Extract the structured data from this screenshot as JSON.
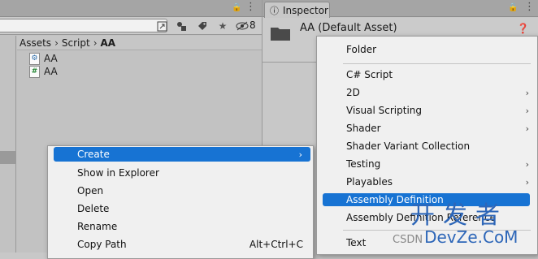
{
  "project": {
    "breadcrumb": [
      "Assets",
      "Script",
      "AA"
    ],
    "hidden_count": "8",
    "files": [
      {
        "name": "AA",
        "icon": "assembly-definition-icon",
        "glyph": "⚙"
      },
      {
        "name": "AA",
        "icon": "csharp-script-icon",
        "glyph": "#"
      }
    ]
  },
  "inspector": {
    "tab_label": "Inspector",
    "title": "AA (Default Asset)"
  },
  "context_menu": {
    "items": [
      {
        "label": "Create",
        "has_submenu": true,
        "selected": true,
        "shortcut": ""
      },
      {
        "label": "Show in Explorer",
        "has_submenu": false,
        "selected": false,
        "shortcut": ""
      },
      {
        "label": "Open",
        "has_submenu": false,
        "selected": false,
        "shortcut": ""
      },
      {
        "label": "Delete",
        "has_submenu": false,
        "selected": false,
        "shortcut": ""
      },
      {
        "label": "Rename",
        "has_submenu": false,
        "selected": false,
        "shortcut": ""
      },
      {
        "label": "Copy Path",
        "has_submenu": false,
        "selected": false,
        "shortcut": "Alt+Ctrl+C"
      }
    ]
  },
  "create_submenu": {
    "items": [
      {
        "label": "Folder",
        "has_submenu": false,
        "selected": false
      },
      {
        "label": "C# Script",
        "has_submenu": false,
        "selected": false
      },
      {
        "label": "2D",
        "has_submenu": true,
        "selected": false
      },
      {
        "label": "Visual Scripting",
        "has_submenu": true,
        "selected": false
      },
      {
        "label": "Shader",
        "has_submenu": true,
        "selected": false
      },
      {
        "label": "Shader Variant Collection",
        "has_submenu": false,
        "selected": false
      },
      {
        "label": "Testing",
        "has_submenu": true,
        "selected": false
      },
      {
        "label": "Playables",
        "has_submenu": true,
        "selected": false
      },
      {
        "label": "Assembly Definition",
        "has_submenu": false,
        "selected": true
      },
      {
        "label": "Assembly Definition Reference",
        "has_submenu": false,
        "selected": false
      },
      {
        "label": "Text",
        "has_submenu": false,
        "selected": false
      }
    ]
  },
  "watermark": {
    "cn": "开发者",
    "prefix": "CSDN",
    "en": "DevZe.CoM"
  },
  "colors": {
    "selection": "#1773d3",
    "watermark": "#2d66b8"
  }
}
